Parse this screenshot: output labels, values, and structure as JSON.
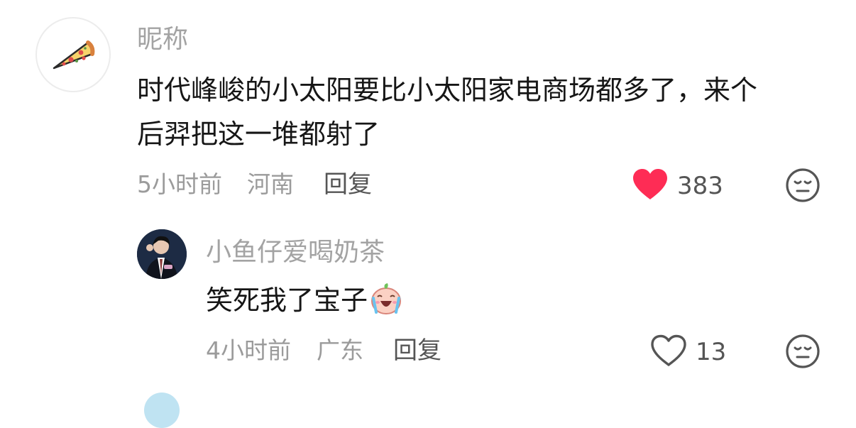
{
  "comments": [
    {
      "avatar_icon": "pizza-slice-icon",
      "username": "昵称",
      "content_line1": "时代峰峻的小太阳要比小太阳家电商场都多了，来个",
      "content_line2": "后羿把这一堆都射了",
      "time": "5小时前",
      "location": "河南",
      "reply_label": "回复",
      "like_count": "383",
      "liked": true,
      "like_color": "#fe2c55"
    },
    {
      "avatar_icon": "user-photo-avatar",
      "username": "小鱼仔爱喝奶茶",
      "content": "笑死我了宝子",
      "emoji": "crying-laughing-sticker",
      "time": "4小时前",
      "location": "广东",
      "reply_label": "回复",
      "like_count": "13",
      "liked": false
    }
  ]
}
